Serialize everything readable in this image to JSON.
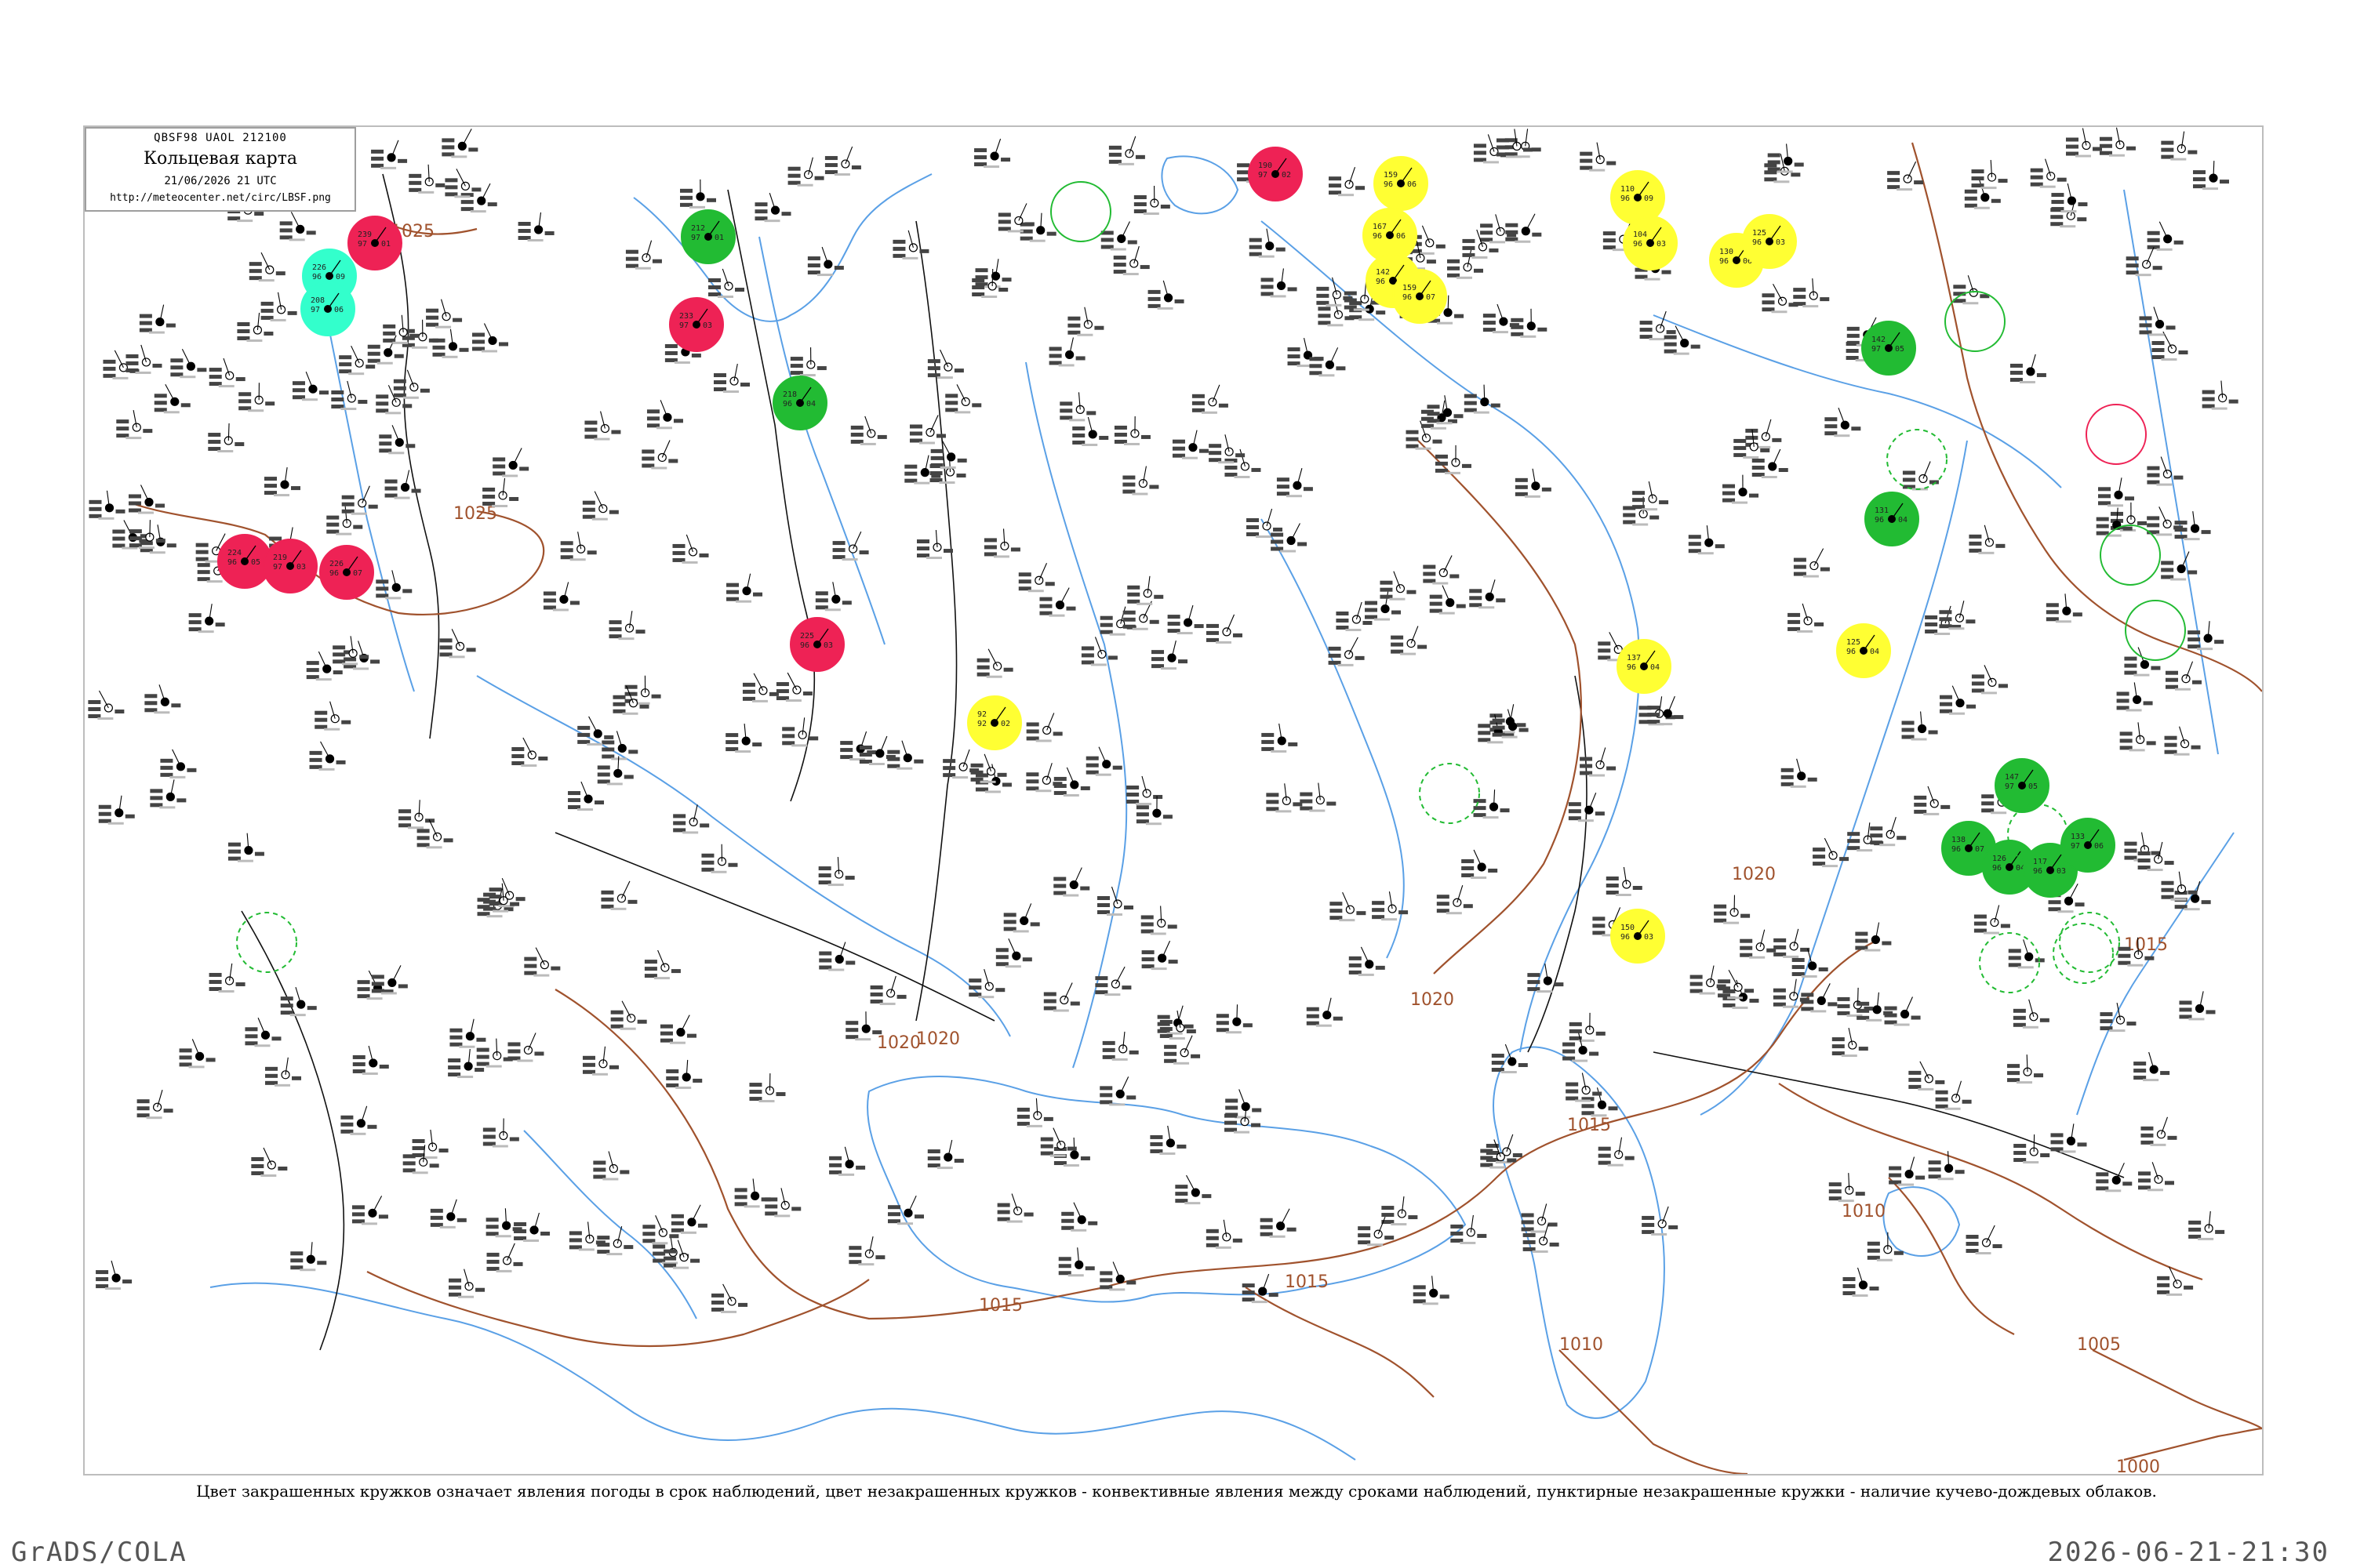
{
  "map": {
    "header_code": "QBSF98  UAOL  212100",
    "title": "Кольцевая карта",
    "timestamp": "21/06/2026 21 UTC",
    "source_url": "http://meteocenter.net/circ/LBSF.png"
  },
  "caption": "Цвет закрашенных кружков означает явления погоды в срок наблюдений, цвет незакрашенных кружков - конвективные явления между сроками наблюдений, пунктирные незакрашенные кружки - наличие кучево-дождевых облаков.",
  "footer": {
    "left": "GrADS/COLA",
    "right": "2026-06-21-21:30"
  },
  "colors": {
    "isobar": "#a0522d",
    "water": "#5aa0e6",
    "border": "#000000",
    "thunderstorm": "#ee2255",
    "rain": "#22bb33",
    "drizzle_fog": "#ffff33",
    "haze": "#99ff66",
    "showers": "#33ffcc"
  },
  "isobars": [
    {
      "label": "1025"
    },
    {
      "label": "1025"
    },
    {
      "label": "1020"
    },
    {
      "label": "1020"
    },
    {
      "label": "1020"
    },
    {
      "label": "1020"
    },
    {
      "label": "1015"
    },
    {
      "label": "1015"
    },
    {
      "label": "1015"
    },
    {
      "label": "1015"
    },
    {
      "label": "1010"
    },
    {
      "label": "1010"
    },
    {
      "label": "1005"
    },
    {
      "label": "1000"
    }
  ],
  "stations": [
    {
      "id": "10400",
      "t": "239",
      "d": "97",
      "p": "01",
      "c": "#ee2255"
    },
    {
      "id": "10338",
      "t": "226",
      "d": "96",
      "p": "09",
      "c": "#33ffcc"
    },
    {
      "id": "12566",
      "t": "208",
      "d": "97",
      "p": "06",
      "c": "#33ffcc"
    },
    {
      "id": "12120",
      "t": "212",
      "d": "97",
      "p": "01",
      "c": "#22bb33"
    },
    {
      "id": "12330",
      "t": "233",
      "d": "97",
      "p": "03",
      "c": "#ee2255"
    },
    {
      "id": "12560",
      "t": "218",
      "d": "96",
      "p": "04",
      "c": "#22bb33"
    },
    {
      "id": "06780",
      "t": "224",
      "d": "96",
      "p": "05",
      "c": "#ee2255"
    },
    {
      "id": "06770",
      "t": "219",
      "d": "97",
      "p": "03",
      "c": "#ee2255"
    },
    {
      "id": "06660",
      "t": "226",
      "d": "96",
      "p": "07",
      "c": "#ee2255"
    },
    {
      "id": "12870",
      "t": "225",
      "d": "96",
      "p": "03",
      "c": "#ee2255"
    },
    {
      "id": "26063",
      "t": "190",
      "d": "97",
      "p": "02",
      "c": "#ee2255"
    },
    {
      "id": "13580",
      "t": "92",
      "d": "92",
      "p": "02",
      "c": "#ffff33"
    },
    {
      "id": "26422",
      "t": "159",
      "d": "96",
      "p": "06",
      "c": "#ffff33"
    },
    {
      "id": "26345",
      "t": "167",
      "d": "96",
      "p": "06",
      "c": "#ffff33"
    },
    {
      "id": "26300",
      "t": "142",
      "d": "96",
      "p": "03",
      "c": "#ffff33"
    },
    {
      "id": "26500",
      "t": "159",
      "d": "96",
      "p": "07",
      "c": "#ffff33"
    },
    {
      "id": "26702",
      "t": "110",
      "d": "96",
      "p": "09",
      "c": "#ffff33"
    },
    {
      "id": "26730",
      "t": "104",
      "d": "96",
      "p": "03",
      "c": "#ffff33"
    },
    {
      "id": "26850",
      "t": "130",
      "d": "96",
      "p": "06",
      "c": "#ffff33"
    },
    {
      "id": "27612",
      "t": "125",
      "d": "96",
      "p": "03",
      "c": "#ffff33"
    },
    {
      "id": "34560",
      "t": "125",
      "d": "96",
      "p": "04",
      "c": "#ffff33"
    },
    {
      "id": "34300",
      "t": "137",
      "d": "96",
      "p": "04",
      "c": "#ffff33"
    },
    {
      "id": "34880",
      "t": "150",
      "d": "96",
      "p": "03",
      "c": "#ffff33"
    },
    {
      "id": "28440",
      "t": "142",
      "d": "97",
      "p": "05",
      "c": "#22bb33"
    },
    {
      "id": "28698",
      "t": "131",
      "d": "96",
      "p": "04",
      "c": "#22bb33"
    },
    {
      "id": "35700",
      "t": "147",
      "d": "97",
      "p": "05",
      "c": "#22bb33"
    },
    {
      "id": "35400",
      "t": "138",
      "d": "96",
      "p": "07",
      "c": "#22bb33"
    },
    {
      "id": "35510",
      "t": "126",
      "d": "96",
      "p": "04",
      "c": "#22bb33"
    },
    {
      "id": "35600",
      "t": "117",
      "d": "96",
      "p": "03",
      "c": "#22bb33"
    },
    {
      "id": "35620",
      "t": "133",
      "d": "97",
      "p": "06",
      "c": "#22bb33"
    }
  ],
  "hollow_stations": [
    {
      "id": "27612h",
      "c": "#22bb33",
      "dashed": false
    },
    {
      "id": "26300h",
      "c": "#22bb33",
      "dashed": true
    },
    {
      "id": "34880h",
      "c": "#22bb33",
      "dashed": true
    },
    {
      "id": "28600h",
      "c": "#22bb33",
      "dashed": false
    },
    {
      "id": "28440h",
      "c": "#22bb33",
      "dashed": true
    },
    {
      "id": "28900h",
      "c": "#ee2255",
      "dashed": false
    },
    {
      "id": "35200h",
      "c": "#22bb33",
      "dashed": false
    },
    {
      "id": "35230h",
      "c": "#22bb33",
      "dashed": false
    },
    {
      "id": "35230h2",
      "c": "#22bb33",
      "dashed": true
    },
    {
      "id": "34900h",
      "c": "#22bb33",
      "dashed": true
    },
    {
      "id": "34950h",
      "c": "#22bb33",
      "dashed": true
    },
    {
      "id": "10400h",
      "c": "#22bb33",
      "dashed": true
    }
  ]
}
